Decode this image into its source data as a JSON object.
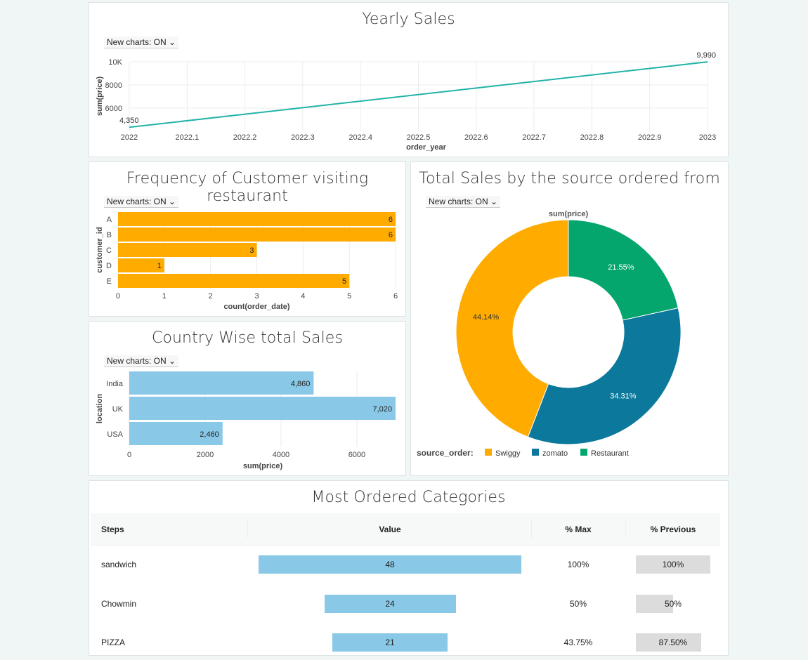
{
  "toggle_label": "New charts: ON",
  "line_chart": {
    "title": "Yearly Sales",
    "chart_data": {
      "type": "line",
      "x": [
        2022,
        2023
      ],
      "y": [
        4350,
        9990
      ],
      "point_labels": [
        "4,350",
        "9,990"
      ],
      "xlabel": "order_year",
      "ylabel": "sum(price)",
      "xticks": [
        "2022",
        "2022.1",
        "2022.2",
        "2022.3",
        "2022.4",
        "2022.5",
        "2022.6",
        "2022.7",
        "2022.8",
        "2022.9",
        "2023"
      ],
      "yticks": [
        "6000",
        "8000",
        "10K"
      ],
      "color": "#22b3a8"
    }
  },
  "freq_chart": {
    "title": "Frequency of Customer visiting restaurant",
    "chart_data": {
      "type": "bar",
      "orientation": "horizontal",
      "categories": [
        "A",
        "B",
        "C",
        "D",
        "E"
      ],
      "values": [
        6,
        6,
        3,
        1,
        5
      ],
      "xlabel": "count(order_date)",
      "ylabel": "customer_id",
      "xticks": [
        "0",
        "1",
        "2",
        "3",
        "4",
        "5",
        "6"
      ],
      "xlim": [
        0,
        6
      ],
      "color": "#ffab00"
    }
  },
  "country_chart": {
    "title": "Country Wise total Sales",
    "chart_data": {
      "type": "bar",
      "orientation": "horizontal",
      "categories": [
        "India",
        "UK",
        "USA"
      ],
      "values": [
        4860,
        7020,
        2460
      ],
      "value_labels": [
        "4,860",
        "7,020",
        "2,460"
      ],
      "xlabel": "sum(price)",
      "ylabel": "location",
      "xticks": [
        "0",
        "2000",
        "4000",
        "6000"
      ],
      "color": "#89c8e6"
    }
  },
  "pie_chart": {
    "title": "Total Sales by the source ordered from",
    "chart_data": {
      "type": "pie",
      "value_title": "sum(price)",
      "legend_title": "source_order:",
      "slices": [
        {
          "name": "Swiggy",
          "percent": 44.14,
          "label": "44.14%",
          "color": "#ffab00"
        },
        {
          "name": "zomato",
          "percent": 34.31,
          "label": "34.31%",
          "color": "#0b789c"
        },
        {
          "name": "Restaurant",
          "percent": 21.55,
          "label": "21.55%",
          "color": "#05a66d"
        }
      ]
    }
  },
  "table": {
    "title": "Most Ordered Categories",
    "headers": [
      "Steps",
      "Value",
      "% Max",
      "% Previous"
    ],
    "rows": [
      {
        "step": "sandwich",
        "value": "48",
        "pct_max": "100%",
        "pct_prev": "100%",
        "value_frac": 1.0,
        "prev_frac": 1.0
      },
      {
        "step": "Chowmin",
        "value": "24",
        "pct_max": "50%",
        "pct_prev": "50%",
        "value_frac": 0.5,
        "prev_frac": 0.5
      },
      {
        "step": "PIZZA",
        "value": "21",
        "pct_max": "43.75%",
        "pct_prev": "87.50%",
        "value_frac": 0.4375,
        "prev_frac": 0.875
      }
    ]
  }
}
